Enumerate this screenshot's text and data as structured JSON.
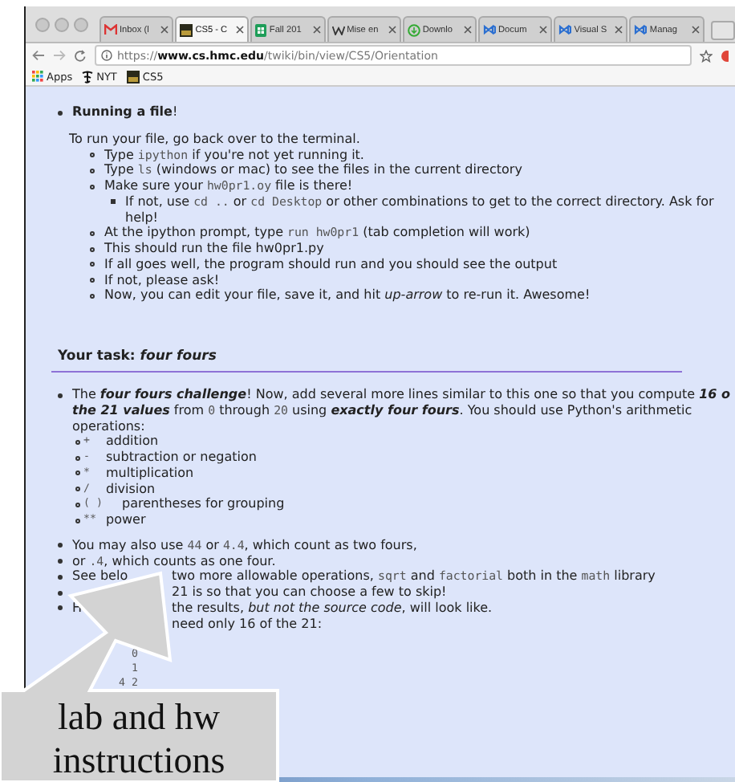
{
  "browser": {
    "tabs": [
      {
        "title": "Inbox (l",
        "selected": false
      },
      {
        "title": "CS5 - C",
        "selected": true
      },
      {
        "title": "Fall 201",
        "selected": false
      },
      {
        "title": "Mise en",
        "selected": false
      },
      {
        "title": "Downlo",
        "selected": false
      },
      {
        "title": "Docum",
        "selected": false
      },
      {
        "title": "Visual S",
        "selected": false
      },
      {
        "title": "Manag",
        "selected": false
      }
    ],
    "address": {
      "scheme": "https://",
      "domain": "www.cs.hmc.edu",
      "path": "/twiki/bin/view/CS5/Orientation"
    },
    "bookmarks": [
      {
        "label": "Apps"
      },
      {
        "label": "NYT"
      },
      {
        "label": "CS5"
      }
    ]
  },
  "page": {
    "blocks": [
      {
        "kind": "bullet",
        "segs": [
          {
            "kind": "bold",
            "text": "Running a file"
          },
          {
            "kind": "text",
            "text": "!"
          }
        ]
      },
      {
        "kind": "para",
        "segs": [
          {
            "kind": "text",
            "text": "To run your file, go back over to the terminal."
          }
        ],
        "children": [
          {
            "kind": "bullet",
            "segs": [
              {
                "kind": "text",
                "text": "Type "
              },
              {
                "kind": "code",
                "text": "ipython"
              },
              {
                "kind": "text",
                "text": " if you're not yet running it."
              }
            ]
          },
          {
            "kind": "bullet",
            "segs": [
              {
                "kind": "text",
                "text": "Type "
              },
              {
                "kind": "code",
                "text": "ls"
              },
              {
                "kind": "text",
                "text": " (windows or mac) to see the files in the current directory"
              }
            ]
          },
          {
            "kind": "bullet",
            "segs": [
              {
                "kind": "text",
                "text": "Make sure your "
              },
              {
                "kind": "code",
                "text": "hw0pr1.oy"
              },
              {
                "kind": "text",
                "text": " file is there!"
              }
            ],
            "children": [
              {
                "kind": "bullet",
                "segs": [
                  {
                    "kind": "text",
                    "text": "If not, use "
                  },
                  {
                    "kind": "code",
                    "text": "cd .."
                  },
                  {
                    "kind": "text",
                    "text": " or "
                  },
                  {
                    "kind": "code",
                    "text": "cd Desktop"
                  },
                  {
                    "kind": "text",
                    "text": " or other combinations to get to the correct directory. Ask for help!"
                  }
                ]
              }
            ]
          },
          {
            "kind": "bullet",
            "segs": [
              {
                "kind": "text",
                "text": "At the ipython prompt, type "
              },
              {
                "kind": "code",
                "text": "run hw0pr1"
              },
              {
                "kind": "text",
                "text": "   (tab completion will work)"
              }
            ]
          },
          {
            "kind": "bullet",
            "segs": [
              {
                "kind": "text",
                "text": "This should run the file hw0pr1.py"
              }
            ]
          },
          {
            "kind": "bullet",
            "segs": [
              {
                "kind": "text",
                "text": "If all goes well, the program should run and you should see the output"
              }
            ]
          },
          {
            "kind": "bullet",
            "segs": [
              {
                "kind": "text",
                "text": "If not, please ask!"
              }
            ]
          },
          {
            "kind": "bullet",
            "segs": [
              {
                "kind": "text",
                "text": "Now, you can edit your file, save it, and hit "
              },
              {
                "kind": "italic",
                "text": "up-arrow"
              },
              {
                "kind": "text",
                "text": " to re-run it. Awesome!"
              }
            ]
          }
        ]
      },
      {
        "kind": "heading",
        "segs": [
          {
            "kind": "bold",
            "text": "Your task: "
          },
          {
            "kind": "bolditalic",
            "text": "four fours"
          }
        ]
      },
      {
        "kind": "bullet",
        "segs": [
          {
            "kind": "text",
            "text": "The "
          },
          {
            "kind": "bolditalic",
            "text": "four fours challenge"
          },
          {
            "kind": "text",
            "text": "!   Now, add several more lines similar to this one so that you compute "
          },
          {
            "kind": "bolditalic",
            "text": "16 o"
          },
          {
            "kind": "br"
          },
          {
            "kind": "bolditalic",
            "text": "the 21 values"
          },
          {
            "kind": "text",
            "text": " from "
          },
          {
            "kind": "code",
            "text": "0"
          },
          {
            "kind": "text",
            "text": " through "
          },
          {
            "kind": "code",
            "text": "20"
          },
          {
            "kind": "text",
            "text": " using "
          },
          {
            "kind": "bolditalic",
            "text": "exactly four fours"
          },
          {
            "kind": "text",
            "text": ". You should use Python's arithmetic"
          },
          {
            "kind": "br"
          },
          {
            "kind": "text",
            "text": "operations:"
          }
        ],
        "children": [
          {
            "kind": "op",
            "symbol": "+",
            "label": "addition"
          },
          {
            "kind": "op",
            "symbol": "-",
            "label": "subtraction or negation"
          },
          {
            "kind": "op",
            "symbol": "*",
            "label": "multiplication"
          },
          {
            "kind": "op",
            "symbol": "/",
            "label": "division"
          },
          {
            "kind": "op",
            "symbol": "(  )",
            "label": "parentheses for grouping"
          },
          {
            "kind": "op",
            "symbol": "**",
            "label": "power"
          }
        ]
      },
      {
        "kind": "bullet",
        "segs": [
          {
            "kind": "text",
            "text": "You may also use "
          },
          {
            "kind": "code",
            "text": "44"
          },
          {
            "kind": "text",
            "text": " or "
          },
          {
            "kind": "code",
            "text": "4.4"
          },
          {
            "kind": "text",
            "text": ", which count as two fours,"
          }
        ]
      },
      {
        "kind": "bullet",
        "segs": [
          {
            "kind": "text",
            "text": "or "
          },
          {
            "kind": "code",
            "text": ".4"
          },
          {
            "kind": "text",
            "text": ", which counts as one four."
          }
        ]
      },
      {
        "kind": "bullet",
        "segs": [
          {
            "kind": "text",
            "text": "See belo"
          },
          {
            "kind": "gap"
          },
          {
            "kind": "text",
            "text": "two more allowable operations, "
          },
          {
            "kind": "code",
            "text": "sqrt"
          },
          {
            "kind": "text",
            "text": " and "
          },
          {
            "kind": "code",
            "text": "factorial"
          },
          {
            "kind": "text",
            "text": " both in the "
          },
          {
            "kind": "code",
            "text": "math"
          },
          {
            "kind": "text",
            "text": " library"
          }
        ]
      },
      {
        "kind": "bullet",
        "segs": [
          {
            "kind": "gap"
          },
          {
            "kind": "text",
            "text": "21 is so that you can choose a few to skip!"
          }
        ]
      },
      {
        "kind": "bullet",
        "segs": [
          {
            "kind": "text",
            "text": "H"
          },
          {
            "kind": "gap"
          },
          {
            "kind": "text",
            "text": "the results, "
          },
          {
            "kind": "italic",
            "text": "but not the source code"
          },
          {
            "kind": "text",
            "text": ", will look like."
          },
          {
            "kind": "br"
          },
          {
            "kind": "gap"
          },
          {
            "kind": "text",
            "text": "need only 16 of the 21:"
          }
        ]
      },
      {
        "kind": "output",
        "rows": [
          {
            "value": "0"
          },
          {
            "value": "1"
          },
          {
            "prefix": "4",
            "value": "2"
          }
        ]
      }
    ]
  },
  "callout": {
    "lines": [
      "lab and hw",
      "instructions"
    ]
  }
}
